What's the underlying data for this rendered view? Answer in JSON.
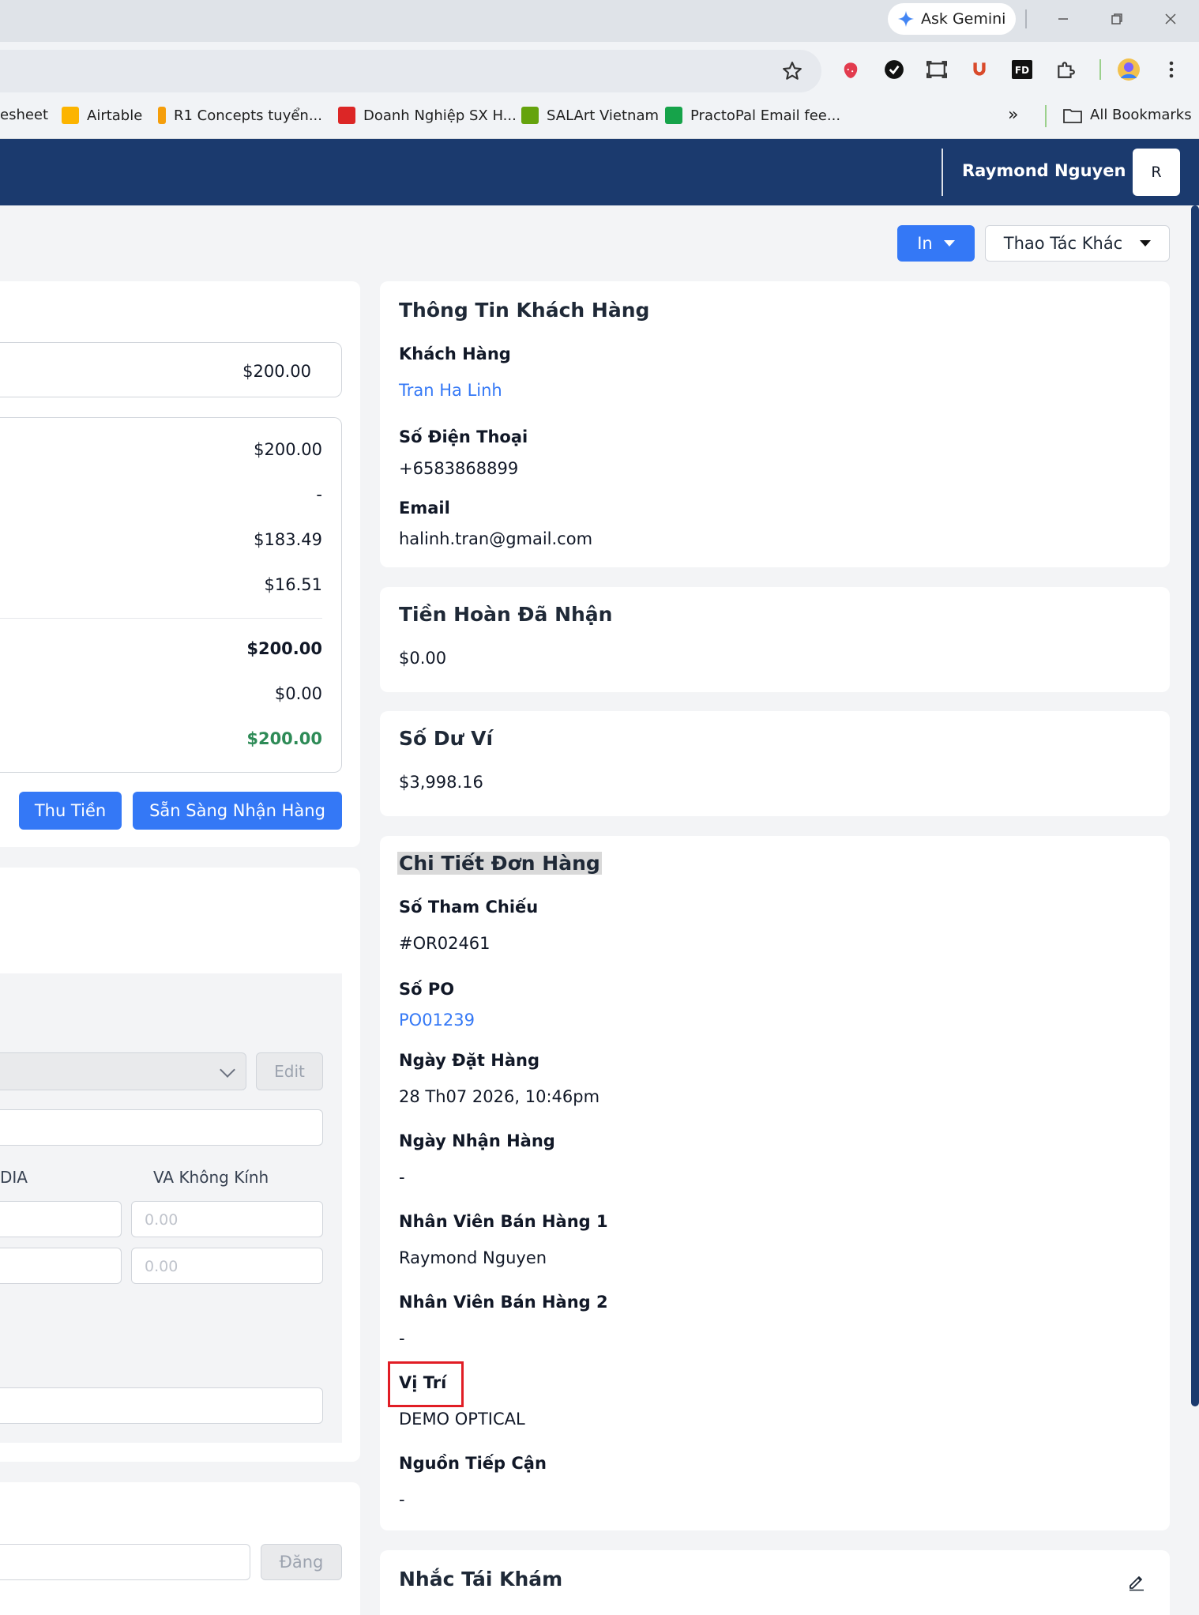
{
  "browser": {
    "gemini_label": "Ask Gemini",
    "bookmarks": [
      {
        "label": "esheet",
        "color": "#ffffff"
      },
      {
        "label": "Airtable",
        "color": "#fcb400"
      },
      {
        "label": "R1 Concepts tuyển...",
        "color": "#f59e0b"
      },
      {
        "label": "Doanh Nghiệp SX H...",
        "color": "#dc2626"
      },
      {
        "label": "SALArt Vietnam",
        "color": "#65a30d"
      },
      {
        "label": "PractoPal Email fee...",
        "color": "#16a34a"
      }
    ],
    "more_bookmarks": "»",
    "all_bookmarks": "All Bookmarks"
  },
  "header": {
    "user_name": "Raymond Nguyen",
    "avatar_initial": "R"
  },
  "actions": {
    "print_label": "In",
    "more_label": "Thao Tác Khác"
  },
  "payment": {
    "total": "$200.00",
    "rows": [
      "$200.00",
      "-",
      "$183.49",
      "$16.51"
    ],
    "paid_total": "$200.00",
    "refund": "$0.00",
    "balance": "$200.00",
    "collect_label": "Thu Tiền",
    "ready_label": "Sẵn Sàng Nhận Hàng"
  },
  "prescription": {
    "edit_label": "Edit",
    "col_left_label": "DIA",
    "col_right_label": "VA Không Kính",
    "placeholder": "0.00",
    "post_label": "Đăng"
  },
  "customer": {
    "title": "Thông Tin Khách Hàng",
    "customer_label": "Khách Hàng",
    "customer_name": "Tran Ha Linh",
    "phone_label": "Số Điện Thoại",
    "phone": "+6583868899",
    "email_label": "Email",
    "email": "halinh.tran@gmail.com"
  },
  "refund_card": {
    "title": "Tiền Hoàn Đã Nhận",
    "value": "$0.00"
  },
  "wallet_card": {
    "title": "Số Dư Ví",
    "value": "$3,998.16"
  },
  "order": {
    "title": "Chi Tiết Đơn Hàng",
    "ref_label": "Số Tham Chiếu",
    "ref": "#OR02461",
    "po_label": "Số PO",
    "po": "PO01239",
    "order_date_label": "Ngày Đặt Hàng",
    "order_date": "28 Th07 2026, 10:46pm",
    "pickup_label": "Ngày Nhận Hàng",
    "pickup": "-",
    "staff1_label": "Nhân Viên Bán Hàng 1",
    "staff1": "Raymond Nguyen",
    "staff2_label": "Nhân Viên Bán Hàng 2",
    "staff2": "-",
    "location_label": "Vị Trí",
    "location": "DEMO OPTICAL",
    "source_label": "Nguồn Tiếp Cận",
    "source": "-"
  },
  "recall": {
    "title": "Nhắc Tái Khám"
  }
}
